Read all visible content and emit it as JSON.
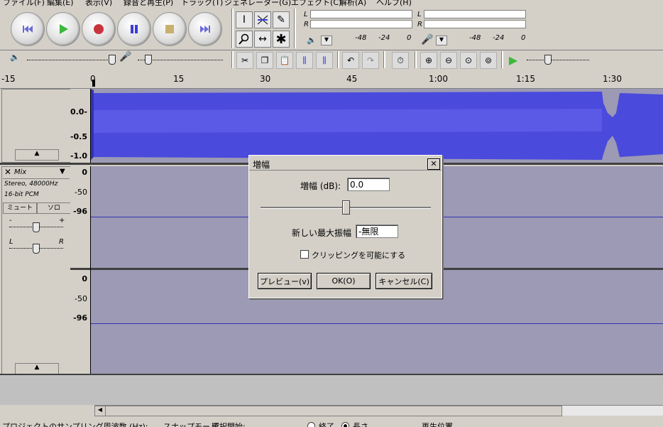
{
  "menu": [
    "ファイル(F)",
    "編集(E)",
    "表示(V)",
    "録音と再生(P)",
    "トラック(T)",
    "ジェネレーター(G)",
    "エフェクト(C)",
    "解析(A)",
    "ヘルプ(H)"
  ],
  "meters": {
    "left": "L",
    "right": "R",
    "scale_a": "-48",
    "scale_b": "-24",
    "scale_c": "0"
  },
  "ruler": {
    "labels": [
      "-15",
      "0",
      "15",
      "30",
      "45",
      "1:00",
      "1:15",
      "1:30"
    ]
  },
  "track1": {
    "scale": [
      "0.0-",
      "-0.5",
      "-1.0"
    ]
  },
  "track2": {
    "name": "Mix",
    "format1": "Stereo, 48000Hz",
    "format2": "16-bit PCM",
    "mute": "ミュート",
    "solo": "ソロ",
    "gain_minus": "-",
    "gain_plus": "+",
    "pan_l": "L",
    "pan_r": "R",
    "scale": [
      "0",
      "-50",
      "-96"
    ],
    "scale2": [
      "0",
      "-50",
      "-96"
    ]
  },
  "dialog": {
    "title": "増幅",
    "gain_label": "増幅 (dB):",
    "gain_value": "0.0",
    "peak_label": "新しい最大振幅",
    "peak_value": "-無限",
    "clip_label": "クリッピングを可能にする",
    "preview": "プレビュー(v)",
    "ok": "OK(O)",
    "cancel": "キャンセル(C)",
    "slider_value": 0.5
  },
  "status": {
    "rate_label": "プロジェクトのサンプリング周波数 (Hz):",
    "snap_label": "スナップモード",
    "sel_label": "選択開始:",
    "end_label": "終了",
    "length_label": "長さ",
    "play_pos": "再生位置"
  },
  "colors": {
    "waveform": "#4444dd",
    "waveform_dark": "#3232b4",
    "track_bg": "#9c9ab4"
  }
}
